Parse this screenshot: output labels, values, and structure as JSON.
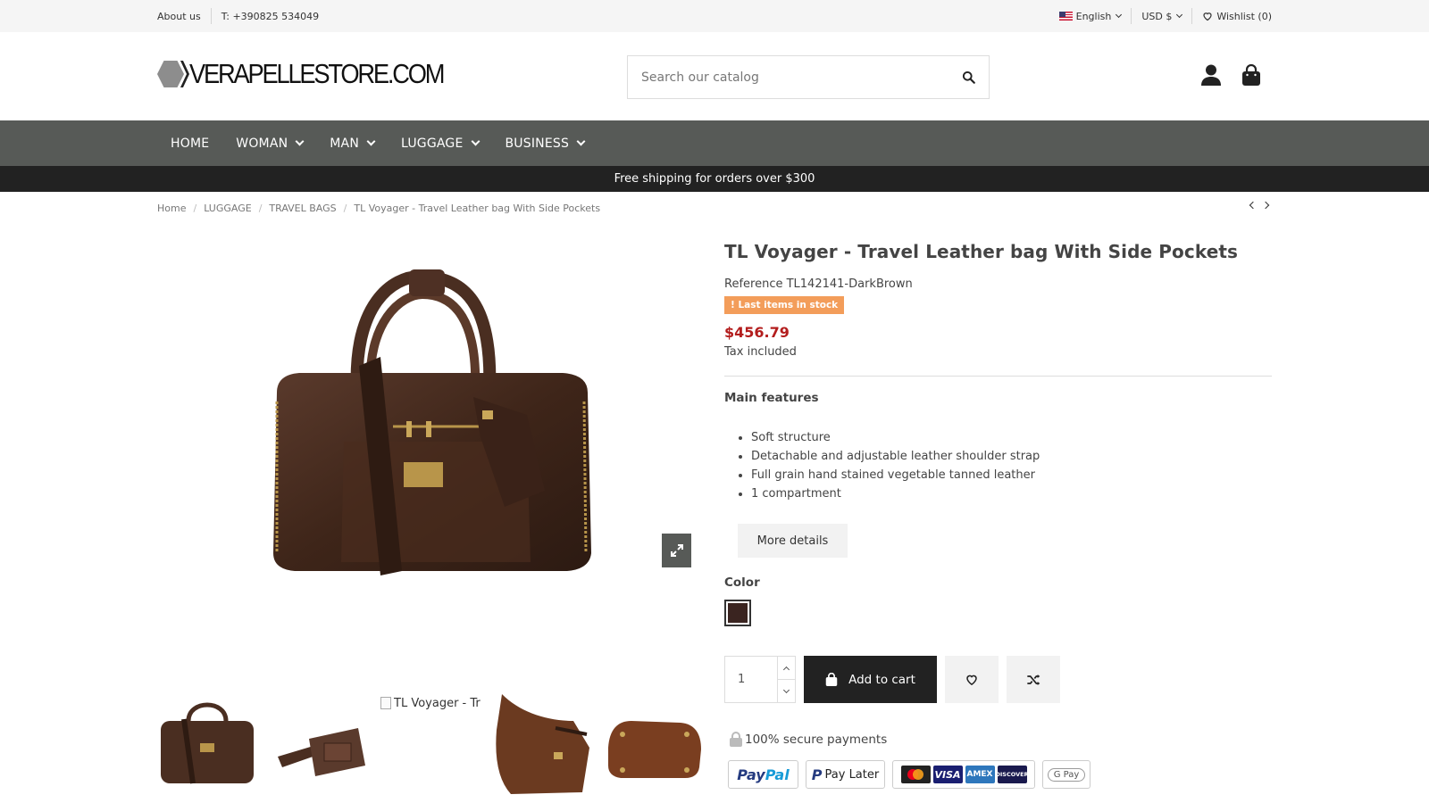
{
  "topbar": {
    "about": "About us",
    "phone": "T: +390825 534049",
    "language": "English",
    "currency": "USD $",
    "wishlist": "Wishlist (0)"
  },
  "header": {
    "logo_text": "VERAPELLESTORE.COM",
    "search_placeholder": "Search our catalog"
  },
  "nav": {
    "items": [
      "HOME",
      "WOMAN",
      "MAN",
      "LUGGAGE",
      "BUSINESS"
    ]
  },
  "promo": "Free shipping for orders over $300",
  "breadcrumb": [
    "Home",
    "LUGGAGE",
    "TRAVEL BAGS",
    "TL Voyager - Travel Leather bag With Side Pockets"
  ],
  "gallery": {
    "broken_thumb_alt": "TL Voyager - Tr"
  },
  "product": {
    "title": "TL Voyager - Travel Leather bag With Side Pockets",
    "reference": "Reference TL142141-DarkBrown",
    "stock_badge": "! Last items in stock",
    "price": "$456.79",
    "tax": "Tax included",
    "features_title": "Main features",
    "features": [
      "Soft structure",
      "Detachable and adjustable leather shoulder strap",
      "Full grain hand stained vegetable tanned leather",
      "1 compartment"
    ],
    "more_details": "More details",
    "color_label": "Color",
    "color_swatch": "#3a2420",
    "quantity": "1",
    "add_to_cart": "Add to cart",
    "secure_payments": "100% secure payments"
  },
  "payments": {
    "paypal_1": "Pay",
    "paypal_2": "Pal",
    "paylater": "Pay Later",
    "visa": "VISA",
    "amex": "AMEX",
    "discover": "DISCOVER",
    "gpay": "G Pay"
  },
  "colors": {
    "nav_bg": "#575a57",
    "promo_bg": "#222222",
    "price": "#b31d1d",
    "stock_badge": "#f39d5a"
  }
}
